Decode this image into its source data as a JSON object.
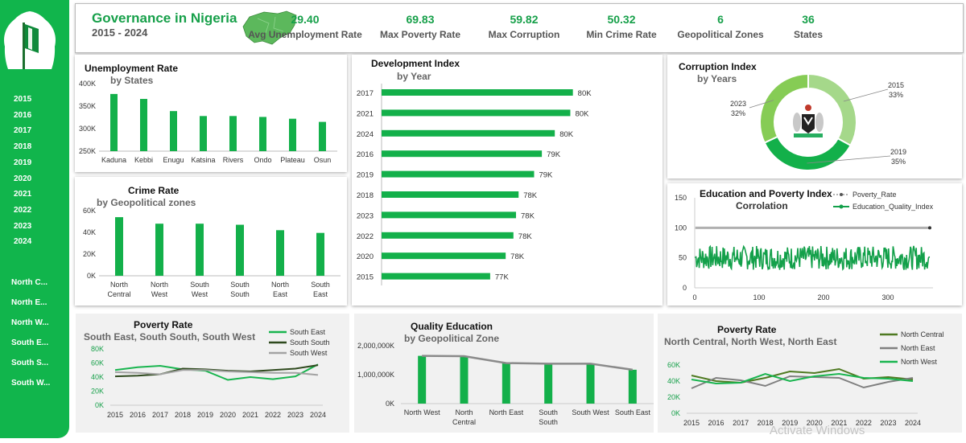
{
  "header": {
    "title": "Governance in Nigeria",
    "period": "2015 - 2024",
    "kpis": [
      {
        "value": "29.40",
        "label": "Avg Unemployment Rate"
      },
      {
        "value": "69.83",
        "label": "Max Poverty Rate"
      },
      {
        "value": "59.82",
        "label": "Max Corruption"
      },
      {
        "value": "50.32",
        "label": "Min Crime Rate"
      },
      {
        "value": "6",
        "label": "Geopolitical Zones"
      },
      {
        "value": "36",
        "label": "States"
      }
    ]
  },
  "sidebar": {
    "years": [
      "2015",
      "2016",
      "2017",
      "2018",
      "2019",
      "2020",
      "2021",
      "2022",
      "2023",
      "2024"
    ],
    "zones": [
      "North C...",
      "North E...",
      "North W...",
      "South E...",
      "South S...",
      "South W..."
    ]
  },
  "colors": {
    "accent": "#11b54c",
    "dark_green": "#2e7d32",
    "olive": "#4f7a22",
    "gray": "#8a8a8a",
    "light_green": "#8fd46b"
  },
  "watermark": "Activate Windows",
  "chart_data": [
    {
      "id": "unemployment",
      "type": "bar",
      "title": "Unemployment Rate",
      "subtitle": "by States",
      "categories": [
        "Kaduna",
        "Kebbi",
        "Enugu",
        "Katsina",
        "Rivers",
        "Ondo",
        "Plateau",
        "Osun"
      ],
      "values": [
        377000,
        366000,
        339000,
        328000,
        328000,
        326000,
        322000,
        315000
      ],
      "ylim": [
        250000,
        400000
      ],
      "yticks": [
        "250K",
        "300K",
        "350K",
        "400K"
      ]
    },
    {
      "id": "crime",
      "type": "bar",
      "title": "Crime Rate",
      "subtitle": "by Geopolitical zones",
      "categories": [
        "North Central",
        "North West",
        "South West",
        "South South",
        "North East",
        "South East"
      ],
      "values": [
        54000,
        48000,
        48000,
        47000,
        42000,
        39500
      ],
      "ylim": [
        0,
        60000
      ],
      "yticks": [
        "0K",
        "20K",
        "40K",
        "60K"
      ]
    },
    {
      "id": "development",
      "type": "bar",
      "orientation": "horizontal",
      "title": "Development Index",
      "subtitle": "by Year",
      "categories": [
        "2017",
        "2021",
        "2024",
        "2016",
        "2019",
        "2018",
        "2023",
        "2022",
        "2020",
        "2015"
      ],
      "values": [
        80400,
        80300,
        79700,
        79200,
        78900,
        78300,
        78200,
        78100,
        77800,
        77200
      ],
      "labels": [
        "80K",
        "80K",
        "80K",
        "79K",
        "79K",
        "78K",
        "78K",
        "78K",
        "78K",
        "77K"
      ],
      "xlim": [
        73000,
        81500
      ]
    },
    {
      "id": "corruption",
      "type": "pie",
      "title": "Corruption Index",
      "subtitle": "by Years",
      "slices": [
        {
          "label": "2015",
          "pct": "33%",
          "value": 33,
          "color": "#a5d88a"
        },
        {
          "label": "2019",
          "pct": "35%",
          "value": 35,
          "color": "#13b04a"
        },
        {
          "label": "2023",
          "pct": "32%",
          "value": 32,
          "color": "#86cc55"
        }
      ]
    },
    {
      "id": "education_poverty",
      "type": "line",
      "title": "Education and Poverty Index",
      "subtitle": "Corrolation",
      "series": [
        {
          "name": "Poverty_Rate",
          "value": 100,
          "color": "#7a7a7a"
        },
        {
          "name": "Education_Quality_Index",
          "range": [
            30,
            70
          ],
          "color": "#13a04a"
        }
      ],
      "xlim": [
        0,
        370
      ],
      "xticks": [
        0,
        100,
        200,
        300
      ],
      "ylim": [
        0,
        150
      ],
      "yticks": [
        0,
        50,
        100,
        150
      ],
      "points": 365
    },
    {
      "id": "poverty_south",
      "type": "line",
      "title": "Poverty Rate",
      "subtitle": "South East, South South, South West",
      "categories": [
        "2015",
        "2016",
        "2017",
        "2018",
        "2019",
        "2020",
        "2021",
        "2022",
        "2023",
        "2024"
      ],
      "ylim": [
        0,
        80000
      ],
      "yticks": [
        "0K",
        "20K",
        "40K",
        "60K",
        "80K"
      ],
      "series": [
        {
          "name": "South East",
          "color": "#19b54f",
          "values": [
            50000,
            54000,
            56000,
            51000,
            49000,
            36000,
            40000,
            37000,
            41000,
            58000
          ]
        },
        {
          "name": "South South",
          "color": "#2f4a1e",
          "values": [
            41000,
            42000,
            44000,
            52000,
            51000,
            49000,
            48000,
            50000,
            52000,
            57000
          ]
        },
        {
          "name": "South West",
          "color": "#a3a3a3",
          "values": [
            47000,
            46000,
            44000,
            50000,
            50000,
            48000,
            47000,
            46000,
            46000,
            43000
          ]
        }
      ]
    },
    {
      "id": "quality_education",
      "type": "bar",
      "title": "Quality Education",
      "subtitle": "by Geopolitical Zone",
      "categories": [
        "North West",
        "North Central",
        "North East",
        "South South",
        "South West",
        "South East"
      ],
      "values": [
        1650000,
        1640000,
        1400000,
        1380000,
        1380000,
        1170000
      ],
      "ylim": [
        0,
        2000000
      ],
      "yticks": [
        "0K",
        "1,000,000K",
        "2,000,000K"
      ]
    },
    {
      "id": "poverty_north",
      "type": "line",
      "title": "Poverty Rate",
      "subtitle": "North Central, North West, North East",
      "categories": [
        "2015",
        "2016",
        "2017",
        "2018",
        "2019",
        "2020",
        "2021",
        "2022",
        "2023",
        "2024"
      ],
      "ylim": [
        0,
        60000
      ],
      "yticks": [
        "0K",
        "20K",
        "40K",
        "60K"
      ],
      "series": [
        {
          "name": "North Central",
          "color": "#4f7a22",
          "values": [
            47000,
            40000,
            38000,
            44000,
            52000,
            50000,
            55000,
            43000,
            45000,
            42000
          ]
        },
        {
          "name": "North East",
          "color": "#808080",
          "values": [
            31000,
            44000,
            41000,
            34000,
            46000,
            45000,
            44000,
            32000,
            39000,
            44000
          ]
        },
        {
          "name": "North West",
          "color": "#19b54f",
          "values": [
            42000,
            37000,
            38000,
            49000,
            40000,
            46000,
            49000,
            44000,
            43000,
            40000
          ]
        }
      ]
    }
  ]
}
